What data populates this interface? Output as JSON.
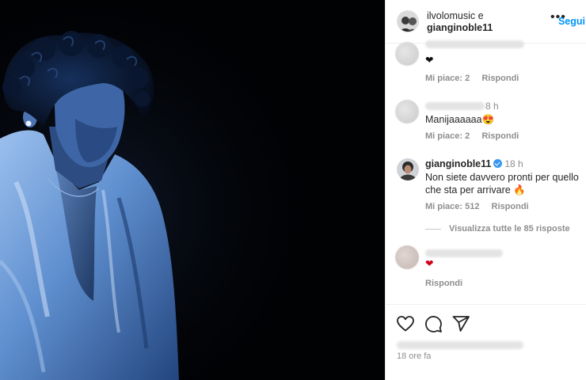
{
  "post": {
    "author_line1": "ilvolomusic e",
    "author_line2": "gianginoble11",
    "follow_label": "Segui",
    "more_label": "•••",
    "time_ago": "18 ore fa"
  },
  "comments": [
    {
      "text": "❤",
      "likes": "Mi piace: 2",
      "reply": "Rispondi",
      "time": ""
    },
    {
      "text": "Manijaaaaaa😍",
      "likes": "Mi piace: 2",
      "reply": "Rispondi",
      "time": "8 h"
    },
    {
      "author": "gianginoble11",
      "time": "18 h",
      "text": "Non siete davvero pronti per quello che sta per arrivare 🔥",
      "likes": "Mi piace: 512",
      "reply": "Rispondi",
      "view_replies": "Visualizza tutte le 85 risposte"
    },
    {
      "text": "❤",
      "reply": "Rispondi"
    }
  ],
  "icons": {
    "like": "heart-icon",
    "comment": "comment-icon",
    "share": "share-icon",
    "verified": "verified-badge-icon"
  },
  "colors": {
    "follow": "#0095f6",
    "verified": "#3897f0",
    "photo_bg": "#010204",
    "shirt": "#5b86c4"
  }
}
